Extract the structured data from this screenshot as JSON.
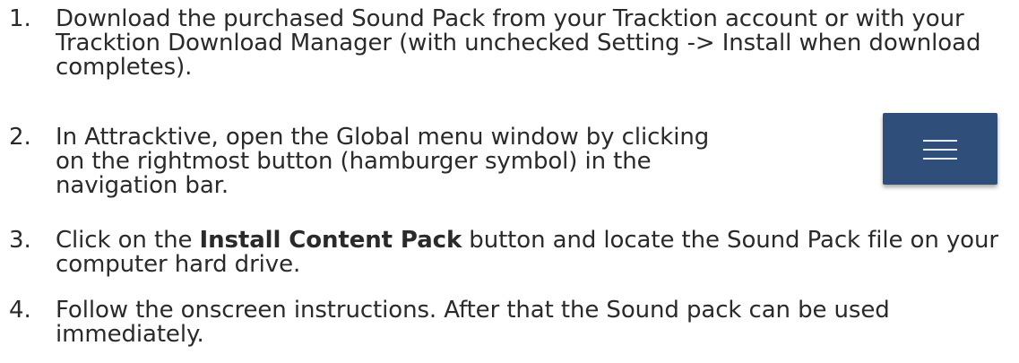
{
  "steps": [
    {
      "number": "1.",
      "text": "Download the purchased Sound Pack from your Tracktion account or with your Tracktion Download Manager (with unchecked Setting -> Install when download completes)."
    },
    {
      "number": "2.",
      "text": "In Attracktive, open the Global menu window by clicking on the rightmost button (hamburger symbol) in the navigation bar."
    },
    {
      "number": "3.",
      "text_before": "Click on the ",
      "bold": "Install Content Pack",
      "text_after": " button and locate the Sound Pack file on your computer hard drive."
    },
    {
      "number": "4.",
      "text": "Follow the onscreen instructions. After that the Sound pack can be used immediately."
    }
  ],
  "menu_button": {
    "icon": "hamburger-menu-icon",
    "background": "#2f4e79",
    "bar_color": "#e8ecf2"
  }
}
